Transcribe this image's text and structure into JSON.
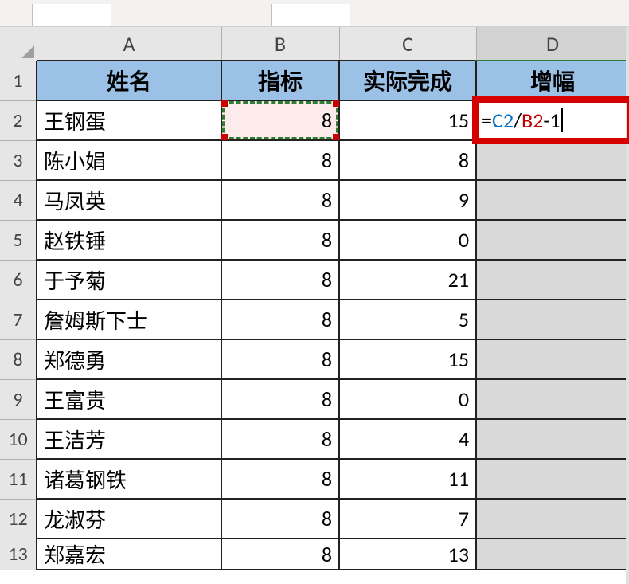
{
  "columns": {
    "A": "A",
    "B": "B",
    "C": "C",
    "D": "D"
  },
  "row_nums": [
    "1",
    "2",
    "3",
    "4",
    "5",
    "6",
    "7",
    "8",
    "9",
    "10",
    "11",
    "12",
    "13"
  ],
  "headers": {
    "A": "姓名",
    "B": "指标",
    "C": "实际完成",
    "D": "增幅"
  },
  "rows": [
    {
      "name": "王钢蛋",
      "target": "8",
      "done": "15"
    },
    {
      "name": "陈小娟",
      "target": "8",
      "done": "8"
    },
    {
      "name": "马凤英",
      "target": "8",
      "done": "9"
    },
    {
      "name": "赵铁锤",
      "target": "8",
      "done": "0"
    },
    {
      "name": "于予菊",
      "target": "8",
      "done": "21"
    },
    {
      "name": "詹姆斯下士",
      "target": "8",
      "done": "5"
    },
    {
      "name": "郑德勇",
      "target": "8",
      "done": "15"
    },
    {
      "name": "王富贵",
      "target": "8",
      "done": "0"
    },
    {
      "name": "王洁芳",
      "target": "8",
      "done": "4"
    },
    {
      "name": "诸葛钢铁",
      "target": "8",
      "done": "11"
    },
    {
      "name": "龙淑芬",
      "target": "8",
      "done": "7"
    },
    {
      "name": "郑嘉宏",
      "target": "8",
      "done": "13"
    }
  ],
  "formula": {
    "eq": "=",
    "ref_c2": "C2",
    "slash": "/",
    "ref_b2": "B2",
    "minus1": "-1"
  },
  "chart_data": {
    "type": "table",
    "columns": [
      "姓名",
      "指标",
      "实际完成",
      "增幅"
    ],
    "rows": [
      [
        "王钢蛋",
        8,
        15,
        null
      ],
      [
        "陈小娟",
        8,
        8,
        null
      ],
      [
        "马凤英",
        8,
        9,
        null
      ],
      [
        "赵铁锤",
        8,
        0,
        null
      ],
      [
        "于予菊",
        8,
        21,
        null
      ],
      [
        "詹姆斯下士",
        8,
        5,
        null
      ],
      [
        "郑德勇",
        8,
        15,
        null
      ],
      [
        "王富贵",
        8,
        0,
        null
      ],
      [
        "王洁芳",
        8,
        4,
        null
      ],
      [
        "诸葛钢铁",
        8,
        11,
        null
      ],
      [
        "龙淑芬",
        8,
        7,
        null
      ],
      [
        "郑嘉宏",
        8,
        13,
        null
      ]
    ],
    "active_formula_cell": "D2",
    "active_formula": "=C2/B2-1"
  }
}
